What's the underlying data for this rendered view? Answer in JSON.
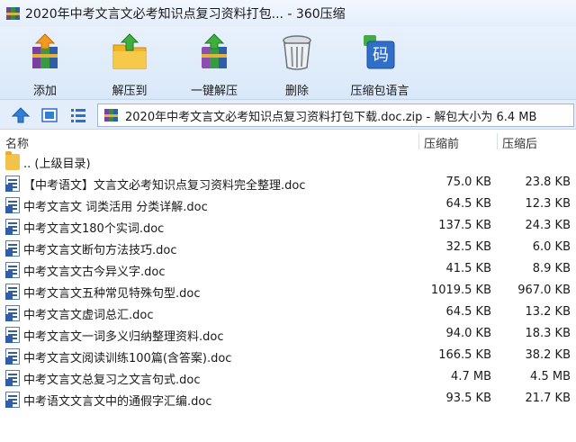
{
  "window": {
    "title": "2020年中考文言文必考知识点复习资料打包... - 360压缩"
  },
  "toolbar": {
    "items": [
      {
        "label": "添加",
        "icon": "add-archive-icon"
      },
      {
        "label": "解压到",
        "icon": "extract-to-folder-icon"
      },
      {
        "label": "一键解压",
        "icon": "one-click-extract-icon"
      },
      {
        "label": "删除",
        "icon": "trash-can-icon"
      },
      {
        "label": "压缩包语言",
        "icon": "archive-language-icon"
      }
    ],
    "language_icon_text": "码"
  },
  "address": {
    "path": "2020年中考文言文必考知识点复习资料打包下载.doc.zip - 解包大小为 6.4 MB"
  },
  "columns": {
    "name": "名称",
    "original": "压缩前",
    "compressed": "压缩后"
  },
  "parent": {
    "label": ".. (上级目录)"
  },
  "files": [
    {
      "name": "【中考语文】文言文必考知识点复习资料完全整理.doc",
      "original": "75.0 KB",
      "compressed": "23.8 KB"
    },
    {
      "name": "中考文言文 词类活用 分类详解.doc",
      "original": "64.5 KB",
      "compressed": "12.3 KB"
    },
    {
      "name": "中考文言文180个实词.doc",
      "original": "137.5 KB",
      "compressed": "24.3 KB"
    },
    {
      "name": "中考文言文断句方法技巧.doc",
      "original": "32.5 KB",
      "compressed": "6.0 KB"
    },
    {
      "name": "中考文言文古今异义字.doc",
      "original": "41.5 KB",
      "compressed": "8.9 KB"
    },
    {
      "name": "中考文言文五种常见特殊句型.doc",
      "original": "1019.5 KB",
      "compressed": "967.0 KB"
    },
    {
      "name": "中考文言文虚词总汇.doc",
      "original": "64.5 KB",
      "compressed": "13.2 KB"
    },
    {
      "name": "中考文言文一词多义归纳整理资料.doc",
      "original": "94.0 KB",
      "compressed": "18.3 KB"
    },
    {
      "name": "中考文言文阅读训练100篇(含答案).doc",
      "original": "166.5 KB",
      "compressed": "38.2 KB"
    },
    {
      "name": "中考文言文总复习之文言句式.doc",
      "original": "4.7 MB",
      "compressed": "4.5 MB"
    },
    {
      "name": "中考语文文言文中的通假字汇编.doc",
      "original": "93.5 KB",
      "compressed": "21.7 KB"
    }
  ]
}
